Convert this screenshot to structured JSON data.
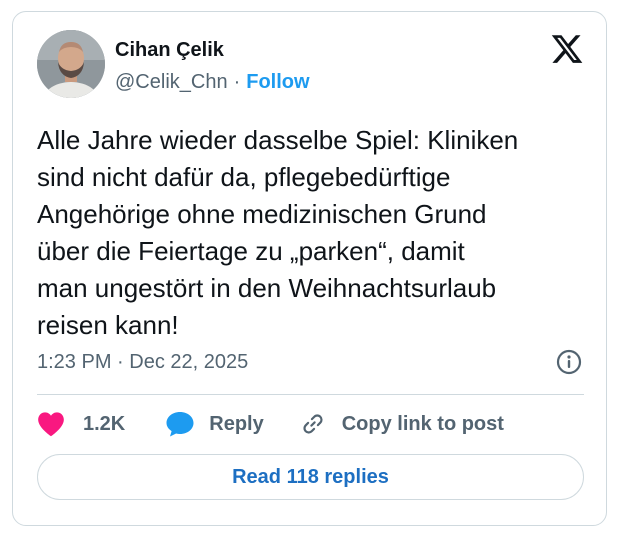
{
  "author": {
    "name": "Cihan Çelik",
    "handle": "@Celik_Chn",
    "separator": "·",
    "follow_label": "Follow",
    "avatar_icon": "profile-photo"
  },
  "brand": {
    "logo_icon": "x-logo"
  },
  "tweet": {
    "text": "Alle Jahre wieder dasselbe Spiel: Kliniken\nsind nicht dafür da, pflegebedürftige\nAngehörige ohne medizinischen Grund\nüber die Feiertage zu „parken“, damit\nman ungestört in den Weihnachtsurlaub\nreisen kann!",
    "timestamp": "1:23 PM · Dec 22, 2025",
    "info_icon": "info-icon"
  },
  "actions": {
    "like_count": "1.2K",
    "like_icon": "heart-icon",
    "reply_label": "Reply",
    "reply_icon": "speech-bubble-icon",
    "copy_link_label": "Copy link to post",
    "copy_link_icon": "link-icon"
  },
  "read_replies_label": "Read 118 replies",
  "colors": {
    "accent": "#1d9bf0",
    "like": "#f91880",
    "reply": "#1d9bf0",
    "muted": "#536471",
    "border": "#cfd9de"
  }
}
